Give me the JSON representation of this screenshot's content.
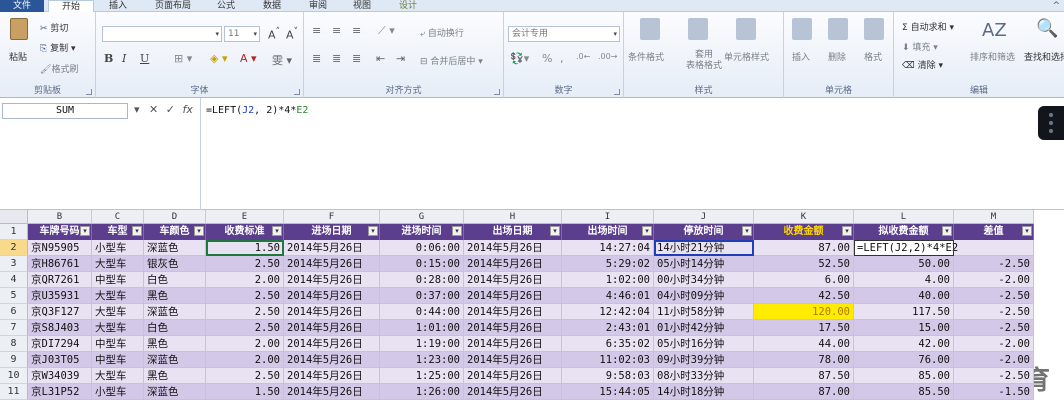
{
  "tabs": [
    "文件",
    "开始",
    "插入",
    "页面布局",
    "公式",
    "数据",
    "审阅",
    "视图",
    "设计"
  ],
  "ribbon": {
    "clipboard": {
      "paste": "粘贴",
      "cut": "剪切",
      "copy": "复制",
      "format_painter": "格式刷",
      "label": "剪贴板"
    },
    "font": {
      "font_name": "",
      "font_size": "11",
      "label": "字体"
    },
    "alignment": {
      "wrap_text": "自动换行",
      "merge_center": "合并后居中",
      "label": "对齐方式"
    },
    "number": {
      "format": "会计专用",
      "label": "数字"
    },
    "styles": {
      "conditional": "条件格式",
      "table_format": "套用\n表格格式",
      "cell_styles": "单元格样式",
      "label": "样式"
    },
    "cells": {
      "insert": "插入",
      "delete": "删除",
      "format": "格式",
      "label": "单元格"
    },
    "editing": {
      "autosum": "自动求和",
      "fill": "填充",
      "clear": "清除",
      "sort_filter": "排序和筛选",
      "find_select": "查找和选择",
      "label": "编辑"
    }
  },
  "formula_bar": {
    "name_box": "SUM",
    "formula_prefix": "=LEFT(",
    "ref1": "J2",
    "formula_mid": ", 2)*4*",
    "ref2": "E2"
  },
  "columns": [
    "B",
    "C",
    "D",
    "E",
    "F",
    "G",
    "H",
    "I",
    "J",
    "K",
    "L",
    "M"
  ],
  "headers": [
    "车牌号码",
    "车型",
    "车颜色",
    "收费标准",
    "进场日期",
    "进场时间",
    "出场日期",
    "出场时间",
    "停放时间",
    "收费金额",
    "拟收费金额",
    "差值"
  ],
  "rows": [
    {
      "n": "1"
    },
    {
      "n": "2",
      "cells": [
        "京N95905",
        "小型车",
        "深蓝色",
        "1.50",
        "2014年5月26日",
        "0:06:00",
        "2014年5月26日",
        "14:27:04",
        "14小时21分钟",
        "87.00",
        "=LEFT(J2,2)*4*E2",
        ""
      ]
    },
    {
      "n": "3",
      "cells": [
        "京H86761",
        "大型车",
        "银灰色",
        "2.50",
        "2014年5月26日",
        "0:15:00",
        "2014年5月26日",
        "5:29:02",
        "05小时14分钟",
        "52.50",
        "50.00",
        "-2.50"
      ]
    },
    {
      "n": "4",
      "cells": [
        "京QR7261",
        "中型车",
        "白色",
        "2.00",
        "2014年5月26日",
        "0:28:00",
        "2014年5月26日",
        "1:02:00",
        "00小时34分钟",
        "6.00",
        "4.00",
        "-2.00"
      ]
    },
    {
      "n": "5",
      "cells": [
        "京U35931",
        "大型车",
        "黑色",
        "2.50",
        "2014年5月26日",
        "0:37:00",
        "2014年5月26日",
        "4:46:01",
        "04小时09分钟",
        "42.50",
        "40.00",
        "-2.50"
      ]
    },
    {
      "n": "6",
      "cells": [
        "京Q3F127",
        "大型车",
        "深蓝色",
        "2.50",
        "2014年5月26日",
        "0:44:00",
        "2014年5月26日",
        "12:42:04",
        "11小时58分钟",
        "120.00",
        "117.50",
        "-2.50"
      ]
    },
    {
      "n": "7",
      "cells": [
        "京S8J403",
        "大型车",
        "白色",
        "2.50",
        "2014年5月26日",
        "1:01:00",
        "2014年5月26日",
        "2:43:01",
        "01小时42分钟",
        "17.50",
        "15.00",
        "-2.50"
      ]
    },
    {
      "n": "8",
      "cells": [
        "京DI7294",
        "中型车",
        "黑色",
        "2.00",
        "2014年5月26日",
        "1:19:00",
        "2014年5月26日",
        "6:35:02",
        "05小时16分钟",
        "44.00",
        "42.00",
        "-2.00"
      ]
    },
    {
      "n": "9",
      "cells": [
        "京J03T05",
        "中型车",
        "深蓝色",
        "2.00",
        "2014年5月26日",
        "1:23:00",
        "2014年5月26日",
        "11:02:03",
        "09小时39分钟",
        "78.00",
        "76.00",
        "-2.00"
      ]
    },
    {
      "n": "10",
      "cells": [
        "京W34039",
        "大型车",
        "黑色",
        "2.50",
        "2014年5月26日",
        "1:25:00",
        "2014年5月26日",
        "9:58:03",
        "08小时33分钟",
        "87.50",
        "85.00",
        "-2.50"
      ]
    },
    {
      "n": "11",
      "cells": [
        "京L31P52",
        "小型车",
        "深蓝色",
        "1.50",
        "2014年5月26日",
        "1:26:00",
        "2014年5月26日",
        "15:44:05",
        "14小时18分钟",
        "87.00",
        "85.50",
        "-1.50"
      ]
    }
  ],
  "watermark": "最需教育",
  "colors": {
    "header_bg": "#5b3f8e",
    "row_light": "#e9e2f3",
    "row_dark": "#d4c8e8",
    "highlight": "#ffec00",
    "selected_row_header": "#f9d98c"
  }
}
